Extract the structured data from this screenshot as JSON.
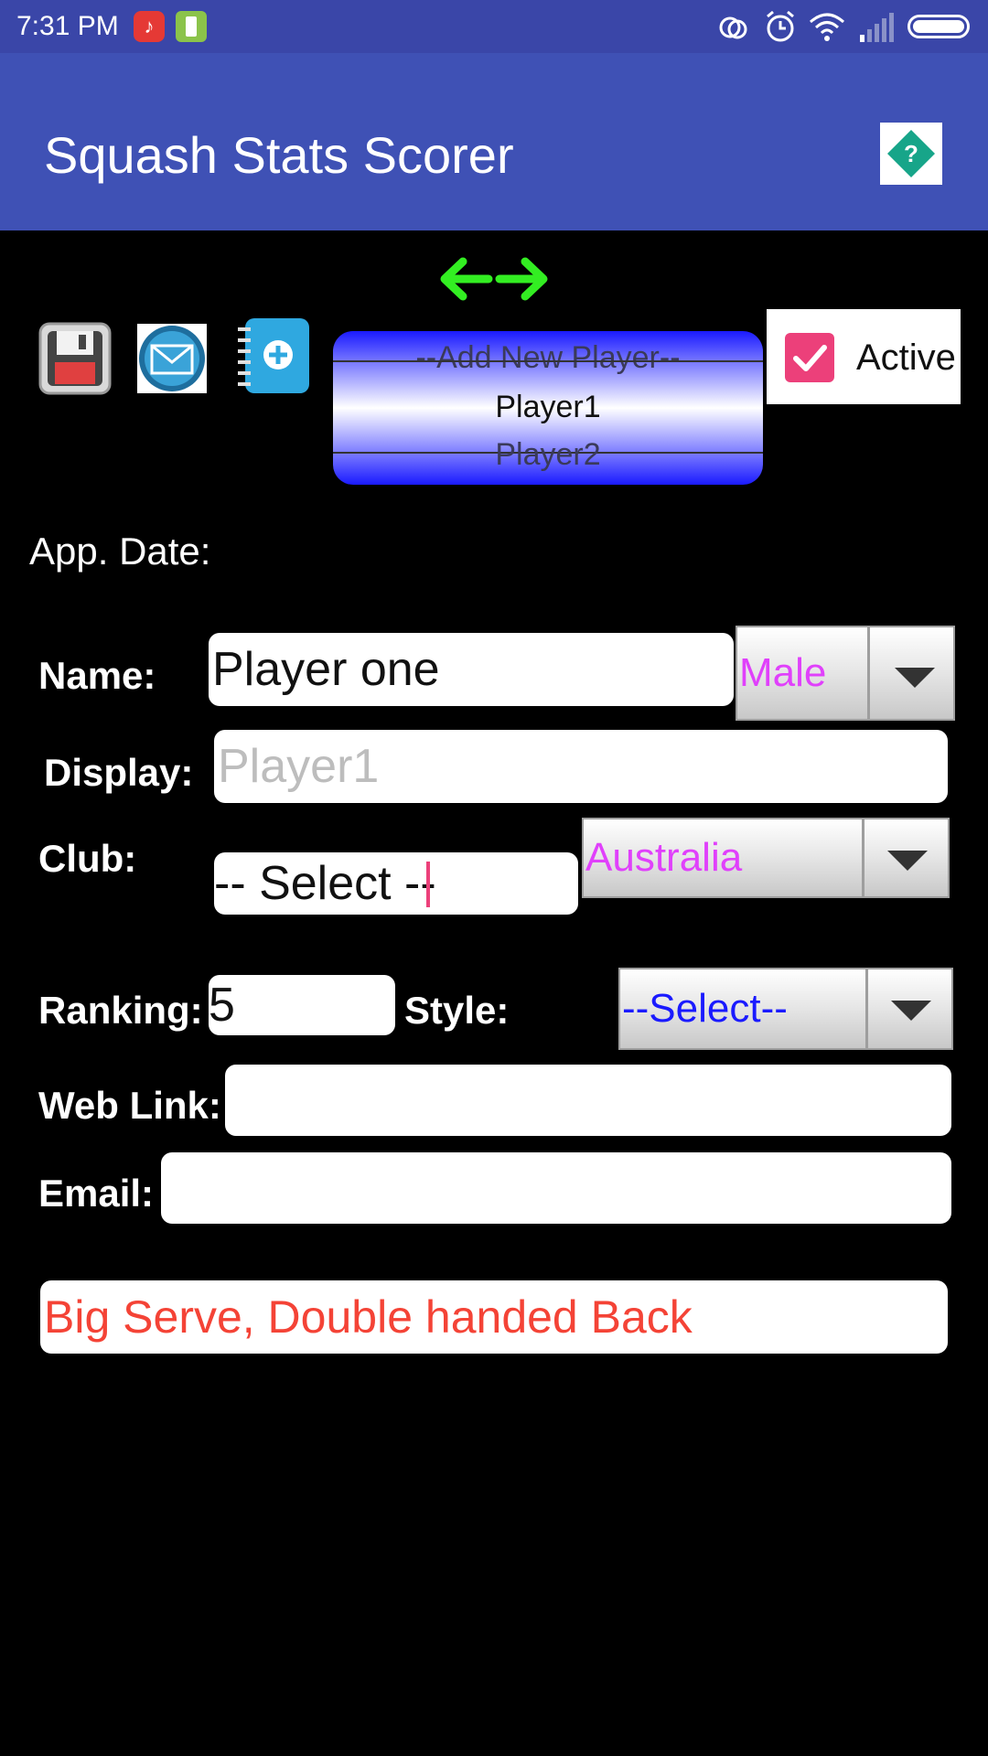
{
  "status_bar": {
    "time": "7:31 PM"
  },
  "app_bar": {
    "title": "Squash Stats Scorer",
    "help_symbol": "?"
  },
  "toolbar": {
    "icons": [
      "save-icon",
      "mail-icon",
      "add-contact-icon",
      "swap-arrows-icon"
    ]
  },
  "player_picker": {
    "items": [
      "--Add New Player--",
      "Player1",
      "Player2"
    ],
    "selected": "Player1"
  },
  "active": {
    "label": "Active",
    "checked": true
  },
  "form": {
    "app_date_label": "App. Date:",
    "name_label": "Name:",
    "name_value": "Player one",
    "gender_value": "Male",
    "display_label": "Display:",
    "display_placeholder": "Player1",
    "club_label": "Club:",
    "club_value": "-- Select --",
    "country_value": "Australia",
    "ranking_label": "Ranking:",
    "ranking_value": "5",
    "style_label": "Style:",
    "style_value": "--Select--",
    "weblink_label": "Web Link:",
    "weblink_value": "",
    "email_label": "Email:",
    "email_value": "",
    "notes_value": "Big Serve, Double handed Back"
  },
  "colors": {
    "status_bar": "#3a46a8",
    "app_bar": "#3f51b5",
    "accent_pink": "#ec407a",
    "gender_text": "#e040fb",
    "style_text": "#1a1aff",
    "notes_text": "#f44336"
  }
}
